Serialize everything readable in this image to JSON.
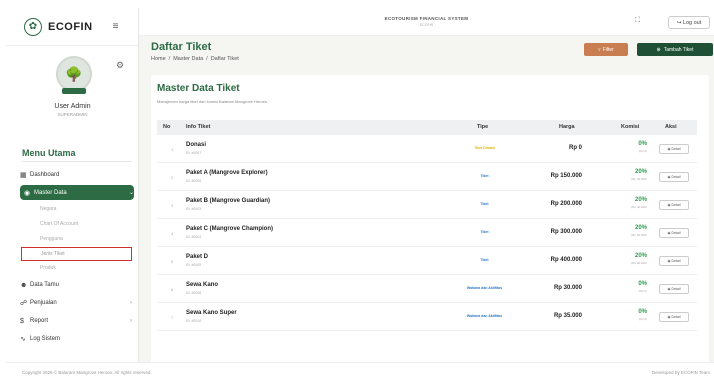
{
  "brand": {
    "name": "ECOFIN",
    "logo_icon": "leaf-icon"
  },
  "topbar": {
    "system_title": "ECOTOURISM FINANCIAL SYSTEM",
    "system_sub": "ECOFIN",
    "logout_label": "Log out"
  },
  "user": {
    "name": "User Admin",
    "role": "SUPERADMIN"
  },
  "menu": {
    "title": "Menu Utama",
    "dashboard": "Dashboard",
    "master_data": "Master Data",
    "sub": {
      "negara": "Negara",
      "chart_of_account": "Chart Of Account",
      "pengguna": "Pengguna",
      "jenis_tiket": "Jenis Tiket",
      "produk": "Produk"
    },
    "data_tamu": "Data Tamu",
    "penjualan": "Penjualan",
    "report": "Report",
    "log_sistem": "Log Sistem"
  },
  "page": {
    "title": "Daftar Tiket",
    "breadcrumb": [
      "Home",
      "/",
      "Master Data",
      "/",
      "Daftar Tiket"
    ],
    "filter_label": "Filter",
    "add_label": "Tambah Tiket"
  },
  "card": {
    "title": "Master Data Tiket",
    "subtitle": "Manajemen harga tiket dan komisi Balaram Mangrove Heroes."
  },
  "table": {
    "headers": {
      "no": "No",
      "info": "Info Tiket",
      "tipe": "Tipe",
      "harga": "Harga",
      "komisi": "Komisi",
      "aksi": "Aksi"
    },
    "detail_label": "Detail",
    "rows": [
      {
        "no": "1",
        "name": "Donasi",
        "id": "ID: #0007",
        "tipe": "Tiket Donasi",
        "tipe_color": "#e6b000",
        "harga": "Rp 0",
        "komisi": "0%",
        "komisi_sub": "(Rp 0)"
      },
      {
        "no": "2",
        "name": "Paket A (Mangrove Explorer)",
        "id": "ID: #0006",
        "tipe": "Tiket",
        "tipe_color": "#2a78c8",
        "harga": "Rp 150.000",
        "komisi": "20%",
        "komisi_sub": "(Rp 30.000)"
      },
      {
        "no": "3",
        "name": "Paket B (Mangrove Guardian)",
        "id": "ID: #0003",
        "tipe": "Tiket",
        "tipe_color": "#2a78c8",
        "harga": "Rp 200.000",
        "komisi": "20%",
        "komisi_sub": "(Rp 40.000)"
      },
      {
        "no": "4",
        "name": "Paket C (Mangrove Champion)",
        "id": "ID: #0004",
        "tipe": "Tiket",
        "tipe_color": "#2a78c8",
        "harga": "Rp 300.000",
        "komisi": "20%",
        "komisi_sub": "(Rp 60.000)"
      },
      {
        "no": "5",
        "name": "Paket D",
        "id": "ID: #0005",
        "tipe": "Tiket",
        "tipe_color": "#2a78c8",
        "harga": "Rp 400.000",
        "komisi": "20%",
        "komisi_sub": "(Rp 80.000)"
      },
      {
        "no": "6",
        "name": "Sewa Kano",
        "id": "ID: #0008",
        "tipe": "Wahana dan Aktifitas",
        "tipe_color": "#2a78c8",
        "harga": "Rp 30.000",
        "komisi": "0%",
        "komisi_sub": "(Rp 0)"
      },
      {
        "no": "7",
        "name": "Sewa Kano Super",
        "id": "ID: #0010",
        "tipe": "Wahana dan Aktifitas",
        "tipe_color": "#2a78c8",
        "harga": "Rp 35.000",
        "komisi": "0%",
        "komisi_sub": "(Rp 0)"
      }
    ]
  },
  "footer": {
    "left": "Copyright 2026 © Balaram Mangrove Heroes. All rights reserved.",
    "right": "Developed by ECOFIN Team"
  }
}
